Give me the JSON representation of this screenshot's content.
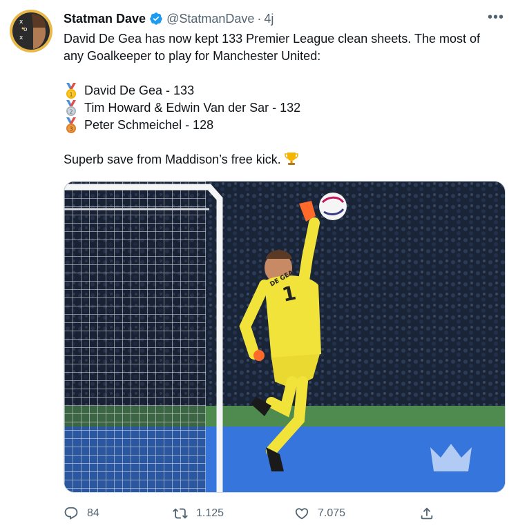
{
  "author": {
    "display_name": "Statman Dave",
    "handle": "@StatmanDave",
    "separator": "·",
    "timestamp": "4j"
  },
  "tweet": {
    "intro": "David De Gea has now kept 133 Premier League clean sheets. The most of any Goalkeeper to play for Manchester United:",
    "ranking": [
      {
        "medal": "gold-medal-icon",
        "text": "David De Gea - 133"
      },
      {
        "medal": "silver-medal-icon",
        "text": "Tim Howard & Edwin Van der Sar - 132"
      },
      {
        "medal": "bronze-medal-icon",
        "text": "Peter Schmeichel - 128"
      }
    ],
    "outro": "Superb save from Maddison’s free kick.",
    "shirt_name": "DE GEA",
    "shirt_number": "1"
  },
  "actions": {
    "replies": "84",
    "retweets": "1.125",
    "likes": "7.075"
  },
  "colors": {
    "text": "#0f1419",
    "secondary": "#536471",
    "verified": "#1d9bf0",
    "kit": "#f2e33a"
  }
}
